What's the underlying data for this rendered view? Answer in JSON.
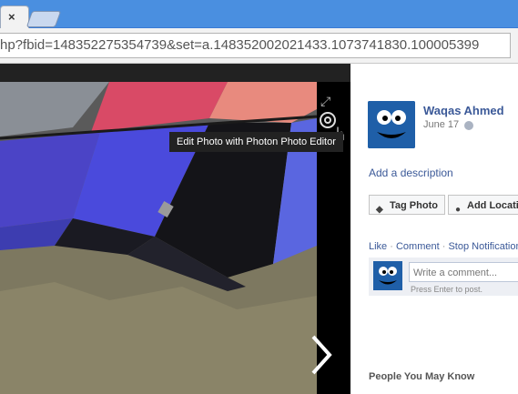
{
  "browser": {
    "tab_close": "×",
    "url": "hp?fbid=148352275354739&set=a.148352002021433.1073741830.100005399"
  },
  "viewer": {
    "tooltip": "Edit Photo with Photon Photo Editor",
    "icons": [
      "expand-icon",
      "photon-editor-icon",
      "next-arrow-icon"
    ]
  },
  "panel": {
    "name": "Waqas Ahmed",
    "date": "June 17",
    "add_description": "Add a description",
    "tag_photo": "Tag Photo",
    "add_location": "Add Location",
    "actions": {
      "like": "Like",
      "comment": "Comment",
      "stop_notifications": "Stop Notifications",
      "separator": "·"
    },
    "comment_placeholder": "Write a comment...",
    "press_enter": "Press Enter to post.",
    "people_you_may_know": "People You May Know"
  },
  "colors": {
    "facebook_blue": "#3b5998",
    "chrome_blue": "#4a8fe0"
  }
}
